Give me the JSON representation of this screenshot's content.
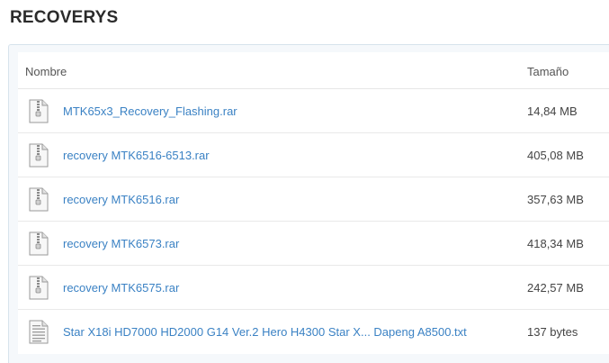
{
  "folder": {
    "title": "RECOVERYS"
  },
  "table": {
    "header": {
      "name": "Nombre",
      "size": "Tamaño"
    },
    "rows": [
      {
        "name": "MTK65x3_Recovery_Flashing.rar",
        "size": "14,84 MB",
        "icon": "zip-file-icon"
      },
      {
        "name": "recovery MTK6516-6513.rar",
        "size": "405,08 MB",
        "icon": "zip-file-icon"
      },
      {
        "name": "recovery MTK6516.rar",
        "size": "357,63 MB",
        "icon": "zip-file-icon"
      },
      {
        "name": "recovery MTK6573.rar",
        "size": "418,34 MB",
        "icon": "zip-file-icon"
      },
      {
        "name": "recovery MTK6575.rar",
        "size": "242,57 MB",
        "icon": "zip-file-icon"
      },
      {
        "name": "Star X18i HD7000 HD2000 G14 Ver.2 Hero H4300 Star X... Dapeng A8500.txt",
        "size": "137 bytes",
        "icon": "text-file-icon"
      }
    ]
  },
  "colors": {
    "link": "#3b82c4",
    "panel_border": "#d7e3ec",
    "panel_bg": "#f5f8fb"
  }
}
